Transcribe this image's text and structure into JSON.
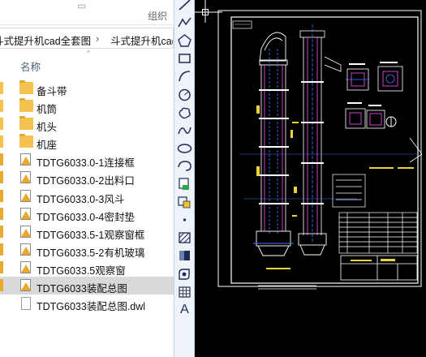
{
  "ribbon": {
    "group_label": "组织"
  },
  "address": {
    "crumb1": "斗式提升机cad全套图",
    "crumb2": "斗式提升机cad"
  },
  "columns": {
    "name_header": "名称"
  },
  "files": [
    {
      "name": "备斗带",
      "type": "folder"
    },
    {
      "name": "机筒",
      "type": "folder"
    },
    {
      "name": "机头",
      "type": "folder"
    },
    {
      "name": "机座",
      "type": "folder"
    },
    {
      "name": "TDTG6033.0-1连接框",
      "type": "dwg"
    },
    {
      "name": "TDTG6033.0-2出料口",
      "type": "dwg"
    },
    {
      "name": "TDTG6033.0-3风斗",
      "type": "dwg"
    },
    {
      "name": "TDTG6033.0-4密封垫",
      "type": "dwg"
    },
    {
      "name": "TDTG6033.5-1观察窗框",
      "type": "dwg"
    },
    {
      "name": "TDTG6033.5-2有机玻璃",
      "type": "dwg"
    },
    {
      "name": "TDTG6033.5观察窗",
      "type": "dwg"
    },
    {
      "name": "TDTG6033装配总图",
      "type": "dwg",
      "selected": true
    },
    {
      "name": "TDTG6033装配总图.dwl",
      "type": "dwl"
    }
  ],
  "toolbar": {
    "tools": [
      "line-icon",
      "polyline-icon",
      "polygon-icon",
      "rectangle-icon",
      "arc-icon",
      "circle-icon",
      "revision-cloud-icon",
      "spline-icon",
      "ellipse-icon",
      "ellipse-arc-icon",
      "insert-block-icon",
      "make-block-icon",
      "point-icon",
      "hatch-icon",
      "gradient-icon",
      "region-icon",
      "table-icon",
      "multiline-text-icon"
    ],
    "text_tool": "A"
  },
  "colors": {
    "accent": "#1e2c58",
    "folder": "#f4c34f",
    "canvas": "#000000",
    "selection": "#d9d9d9"
  }
}
